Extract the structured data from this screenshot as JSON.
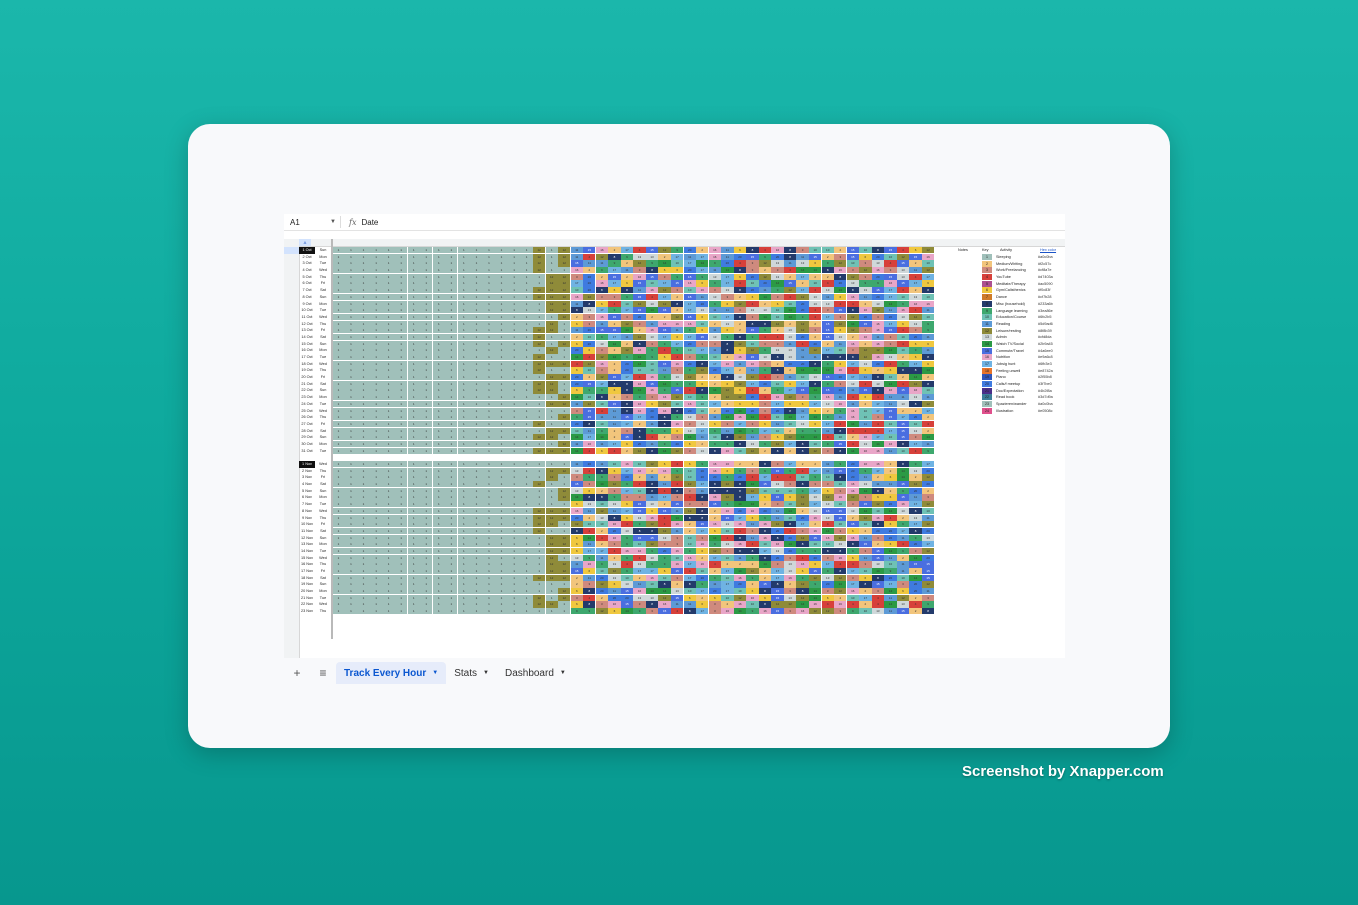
{
  "formula_bar": {
    "cell_ref": "A1",
    "fx": "fx",
    "value": "Date"
  },
  "tabs": [
    {
      "label": "Track Every Hour",
      "active": true
    },
    {
      "label": "Stats",
      "active": false
    },
    {
      "label": "Dashboard",
      "active": false
    }
  ],
  "key_panel": {
    "headers": {
      "notes": "Notes",
      "key": "Key",
      "activity": "Activity",
      "hex": "Hex color"
    },
    "items": [
      {
        "key": "1",
        "activity": "Sleeping",
        "hex": "#a0c0ba"
      },
      {
        "key": "2",
        "activity": "Medium/Writing",
        "hex": "#f2c57c"
      },
      {
        "key": "3",
        "activity": "Work/Freelancing",
        "hex": "#cf8a7e"
      },
      {
        "key": "4",
        "activity": "YouTube",
        "hex": "#d7403a"
      },
      {
        "key": "5",
        "activity": "Meditate/Therapy",
        "hex": "#ac5090"
      },
      {
        "key": "6",
        "activity": "Gym/Calisthenics",
        "hex": "#f0c83f"
      },
      {
        "key": "7",
        "activity": "Dance",
        "hex": "#cf7b28"
      },
      {
        "key": "8",
        "activity": "Misc (household)",
        "hex": "#233a6b"
      },
      {
        "key": "9",
        "activity": "Language learning",
        "hex": "#3ea86e"
      },
      {
        "key": "10",
        "activity": "Education/Course",
        "hex": "#6fc2b5"
      },
      {
        "key": "11",
        "activity": "Reading",
        "hex": "#5d9ad6"
      },
      {
        "key": "12",
        "activity": "Leisure/resting",
        "hex": "#8f8b39"
      },
      {
        "key": "13",
        "activity": "Admin",
        "hex": "#cfd8da"
      },
      {
        "key": "14",
        "activity": "Watch TV/Social",
        "hex": "#2b9a45"
      },
      {
        "key": "15",
        "activity": "Commute/Travel",
        "hex": "#4a6ee0"
      },
      {
        "key": "16",
        "activity": "Nutrition",
        "hex": "#e9a6c8"
      },
      {
        "key": "17",
        "activity": "Jobsig hunt",
        "hex": "#6fb3e3"
      },
      {
        "key": "18",
        "activity": "Feeling unwell",
        "hex": "#e8742a"
      },
      {
        "key": "19",
        "activity": "Piano",
        "hex": "#2f55b8"
      },
      {
        "key": "20",
        "activity": "Calls/f meetup",
        "hex": "#3f7be0"
      },
      {
        "key": "21",
        "activity": "Doc/Expectation",
        "hex": "#4b2f8a"
      },
      {
        "key": "22",
        "activity": "Read book",
        "hex": "#3d7d9a"
      },
      {
        "key": "23",
        "activity": "Spazieren/wander",
        "hex": "#a0c0ba"
      },
      {
        "key": "24",
        "activity": "Illustration",
        "hex": "#e0508c"
      }
    ]
  },
  "rows": [
    {
      "date": "1 Oct",
      "day": "Sun"
    },
    {
      "date": "2 Oct",
      "day": "Mon"
    },
    {
      "date": "3 Oct",
      "day": "Tue"
    },
    {
      "date": "4 Oct",
      "day": "Wed"
    },
    {
      "date": "5 Oct",
      "day": "Thu"
    },
    {
      "date": "6 Oct",
      "day": "Fri"
    },
    {
      "date": "7 Oct",
      "day": "Sat"
    },
    {
      "date": "8 Oct",
      "day": "Sun"
    },
    {
      "date": "9 Oct",
      "day": "Mon"
    },
    {
      "date": "10 Oct",
      "day": "Tue"
    },
    {
      "date": "11 Oct",
      "day": "Wed"
    },
    {
      "date": "12 Oct",
      "day": "Thu"
    },
    {
      "date": "13 Oct",
      "day": "Fri"
    },
    {
      "date": "14 Oct",
      "day": "Sat"
    },
    {
      "date": "15 Oct",
      "day": "Sun"
    },
    {
      "date": "16 Oct",
      "day": "Mon"
    },
    {
      "date": "17 Oct",
      "day": "Tue"
    },
    {
      "date": "18 Oct",
      "day": "Wed"
    },
    {
      "date": "19 Oct",
      "day": "Thu"
    },
    {
      "date": "20 Oct",
      "day": "Fri"
    },
    {
      "date": "21 Oct",
      "day": "Sat"
    },
    {
      "date": "22 Oct",
      "day": "Sun"
    },
    {
      "date": "23 Oct",
      "day": "Mon"
    },
    {
      "date": "24 Oct",
      "day": "Tue"
    },
    {
      "date": "25 Oct",
      "day": "Wed"
    },
    {
      "date": "26 Oct",
      "day": "Thu"
    },
    {
      "date": "27 Oct",
      "day": "Fri"
    },
    {
      "date": "28 Oct",
      "day": "Sat"
    },
    {
      "date": "29 Oct",
      "day": "Sun"
    },
    {
      "date": "30 Oct",
      "day": "Mon"
    },
    {
      "date": "31 Oct",
      "day": "Tue"
    },
    {
      "date": "",
      "day": ""
    },
    {
      "date": "1 Nov",
      "day": "Wed"
    },
    {
      "date": "2 Nov",
      "day": "Thu"
    },
    {
      "date": "3 Nov",
      "day": "Fri"
    },
    {
      "date": "4 Nov",
      "day": "Sat"
    },
    {
      "date": "5 Nov",
      "day": "Sun"
    },
    {
      "date": "6 Nov",
      "day": "Mon"
    },
    {
      "date": "7 Nov",
      "day": "Tue"
    },
    {
      "date": "8 Nov",
      "day": "Wed"
    },
    {
      "date": "9 Nov",
      "day": "Thu"
    },
    {
      "date": "10 Nov",
      "day": "Fri"
    },
    {
      "date": "11 Nov",
      "day": "Sat"
    },
    {
      "date": "12 Nov",
      "day": "Sun"
    },
    {
      "date": "13 Nov",
      "day": "Mon"
    },
    {
      "date": "14 Nov",
      "day": "Tue"
    },
    {
      "date": "15 Nov",
      "day": "Wed"
    },
    {
      "date": "16 Nov",
      "day": "Thu"
    },
    {
      "date": "17 Nov",
      "day": "Fri"
    },
    {
      "date": "18 Nov",
      "day": "Sat"
    },
    {
      "date": "19 Nov",
      "day": "Sun"
    },
    {
      "date": "20 Nov",
      "day": "Mon"
    },
    {
      "date": "21 Nov",
      "day": "Tue"
    },
    {
      "date": "22 Nov",
      "day": "Wed"
    },
    {
      "date": "23 Nov",
      "day": "Thu"
    }
  ],
  "credit": "Screenshot by Xnapper.com"
}
